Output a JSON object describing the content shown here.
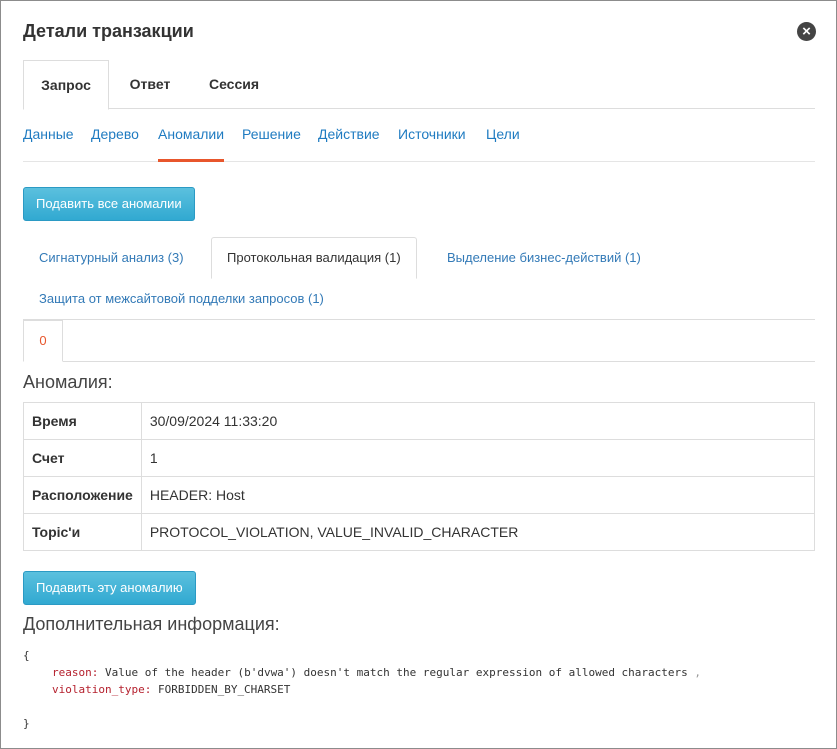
{
  "window": {
    "title": "Детали транзакции",
    "close_icon": "close-icon"
  },
  "main_tabs": [
    {
      "label": "Запрос",
      "active": true
    },
    {
      "label": "Ответ",
      "active": false
    },
    {
      "label": "Сессия",
      "active": false
    }
  ],
  "sub_nav": [
    {
      "label": "Данные",
      "active": false
    },
    {
      "label": "Дерево",
      "active": false
    },
    {
      "label": "Аномалии",
      "active": true
    },
    {
      "label": "Решение",
      "active": false
    },
    {
      "label": "Действие",
      "active": false
    },
    {
      "label": "Источники",
      "active": false
    },
    {
      "label": "Цели",
      "active": false
    }
  ],
  "buttons": {
    "suppress_all": "Подавить все аномалии",
    "suppress_this": "Подавить эту аномалию"
  },
  "anomaly_tabs": [
    {
      "label": "Сигнатурный анализ (3)",
      "active": false
    },
    {
      "label": "Протокольная валидация (1)",
      "active": true
    },
    {
      "label": "Выделение бизнес-действий (1)",
      "active": false
    },
    {
      "label": "Защита от межсайтовой подделки запросов (1)",
      "active": false
    }
  ],
  "index_tab": "0",
  "anomaly_heading": "Аномалия:",
  "anomaly_table": [
    {
      "key": "Время",
      "value": "30/09/2024 11:33:20"
    },
    {
      "key": "Счет",
      "value": "1"
    },
    {
      "key": "Расположение",
      "value": "HEADER: Host"
    },
    {
      "key": "Topic'и",
      "value": "PROTOCOL_VIOLATION, VALUE_INVALID_CHARACTER"
    }
  ],
  "extra_heading": "Дополнительная информация:",
  "extra_info": {
    "open_brace": "{",
    "close_brace": "}",
    "comma": ",",
    "fields": [
      {
        "key": "reason",
        "value": "Value of the header (b'dvwa') doesn't match the regular expression of allowed characters"
      },
      {
        "key": "violation_type",
        "value": "FORBIDDEN_BY_CHARSET"
      }
    ]
  },
  "colors": {
    "link": "#1f7bc1",
    "accent": "#e8562c",
    "button": "#31a9d1",
    "json_key": "#b5212e"
  }
}
